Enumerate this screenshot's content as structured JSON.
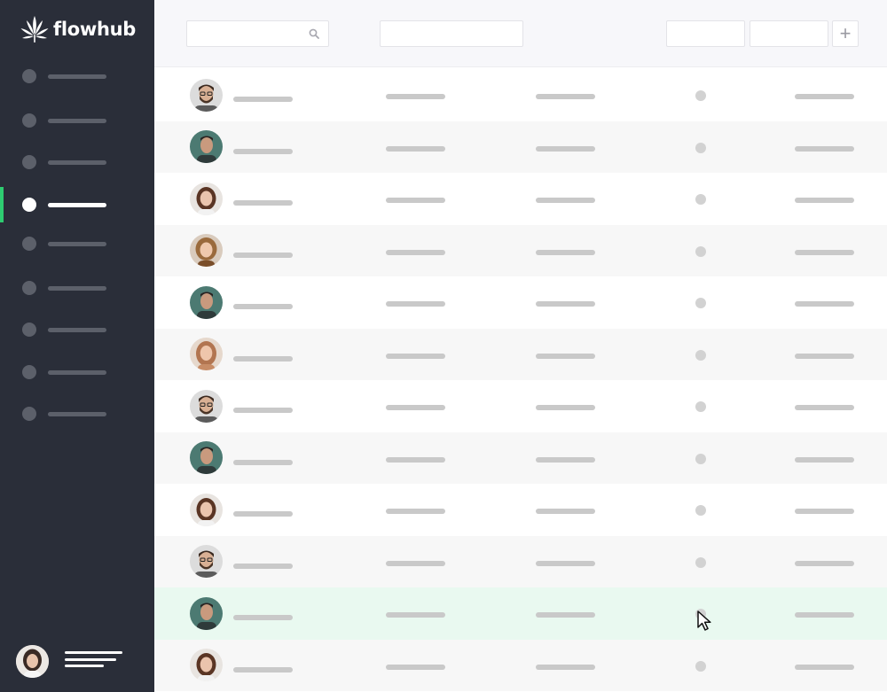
{
  "brand": {
    "name": "flowhub",
    "accent": "#2ecc71",
    "sidebar_bg": "#2a2e39"
  },
  "sidebar": {
    "items": [
      {
        "label": "",
        "active": false
      },
      {
        "label": "",
        "active": false
      },
      {
        "label": "",
        "active": false
      },
      {
        "label": "",
        "active": true
      },
      {
        "label": "",
        "active": false
      },
      {
        "label": "",
        "active": false
      },
      {
        "label": "",
        "active": false
      },
      {
        "label": "",
        "active": false
      },
      {
        "label": "",
        "active": false
      }
    ],
    "profile": {
      "name": ""
    }
  },
  "toolbar": {
    "search": {
      "value": "",
      "placeholder": "",
      "icon": "search-icon"
    },
    "filter": {
      "value": ""
    },
    "action_1": {
      "label": ""
    },
    "action_2": {
      "label": ""
    },
    "add_button": {
      "label": "+",
      "icon": "plus-icon"
    }
  },
  "table": {
    "rows": [
      {
        "avatar": "man-beard-glasses",
        "highlight": false
      },
      {
        "avatar": "man-profile-dark",
        "highlight": false
      },
      {
        "avatar": "woman-brown-hair",
        "highlight": false
      },
      {
        "avatar": "woman-curly-hair",
        "highlight": false
      },
      {
        "avatar": "man-profile-dark",
        "highlight": false
      },
      {
        "avatar": "woman-long-hair",
        "highlight": false
      },
      {
        "avatar": "man-beard-glasses",
        "highlight": false
      },
      {
        "avatar": "man-profile-dark",
        "highlight": false
      },
      {
        "avatar": "woman-brown-hair",
        "highlight": false
      },
      {
        "avatar": "man-beard-glasses",
        "highlight": false
      },
      {
        "avatar": "man-profile-dark",
        "highlight": true
      },
      {
        "avatar": "woman-brown-hair",
        "highlight": false
      }
    ],
    "row_highlight_color": "#e9f9f0"
  },
  "cursor": {
    "icon": "mouse-pointer-icon"
  }
}
